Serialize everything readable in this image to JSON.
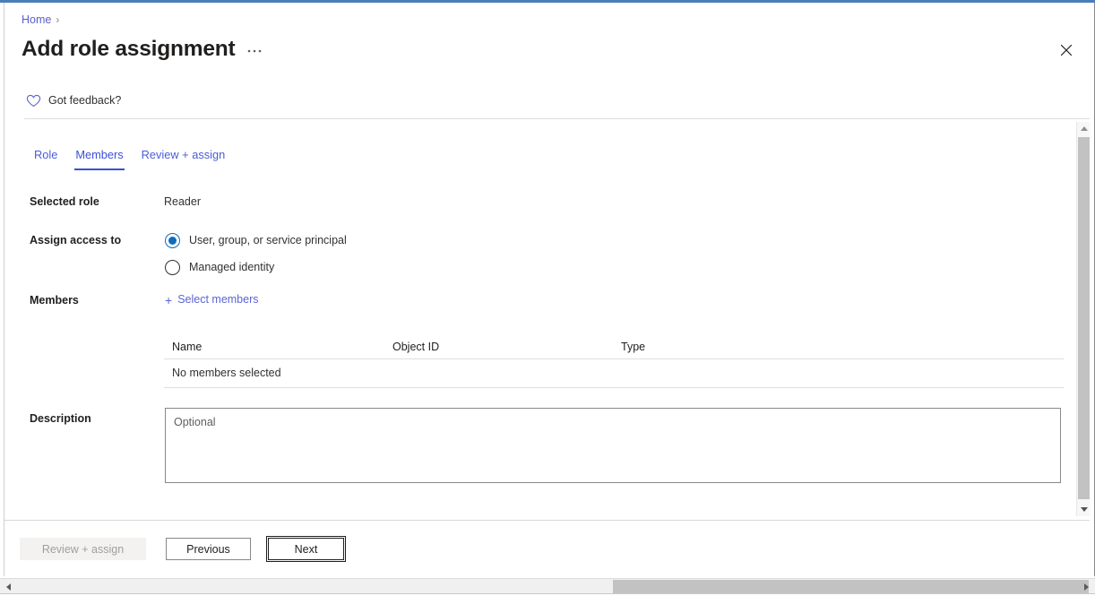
{
  "window": {
    "accent_color": "#4a7ebb",
    "close_label": "Close"
  },
  "header": {
    "breadcrumb": {
      "home": "Home",
      "separator": "›"
    },
    "title": "Add role assignment",
    "more_label": "•••"
  },
  "feedback": {
    "icon": "heart-icon",
    "label": "Got feedback?"
  },
  "tabs": [
    {
      "label": "Role",
      "active": false
    },
    {
      "label": "Members",
      "active": true
    },
    {
      "label": "Review + assign",
      "active": false
    }
  ],
  "form": {
    "selected_role": {
      "label": "Selected role",
      "value": "Reader"
    },
    "assign_access_to": {
      "label": "Assign access to",
      "options": [
        {
          "label": "User, group, or service principal",
          "checked": true
        },
        {
          "label": "Managed identity",
          "checked": false
        }
      ]
    },
    "members": {
      "label": "Members",
      "select_link": "Select members",
      "plus_glyph": "+"
    },
    "description": {
      "label": "Description",
      "value": "",
      "placeholder": "Optional"
    }
  },
  "members_table": {
    "columns": [
      "Name",
      "Object ID",
      "Type"
    ],
    "rows": [],
    "empty_message": "No members selected"
  },
  "footer": {
    "review_assign": "Review + assign",
    "previous": "Previous",
    "next": "Next"
  },
  "colors": {
    "link": "#5b5fc7",
    "tab_active": "#3b4fd8",
    "radio_checked": "#0f6cbd",
    "title": "#201f1e",
    "disabled_text": "#a19f9d"
  }
}
